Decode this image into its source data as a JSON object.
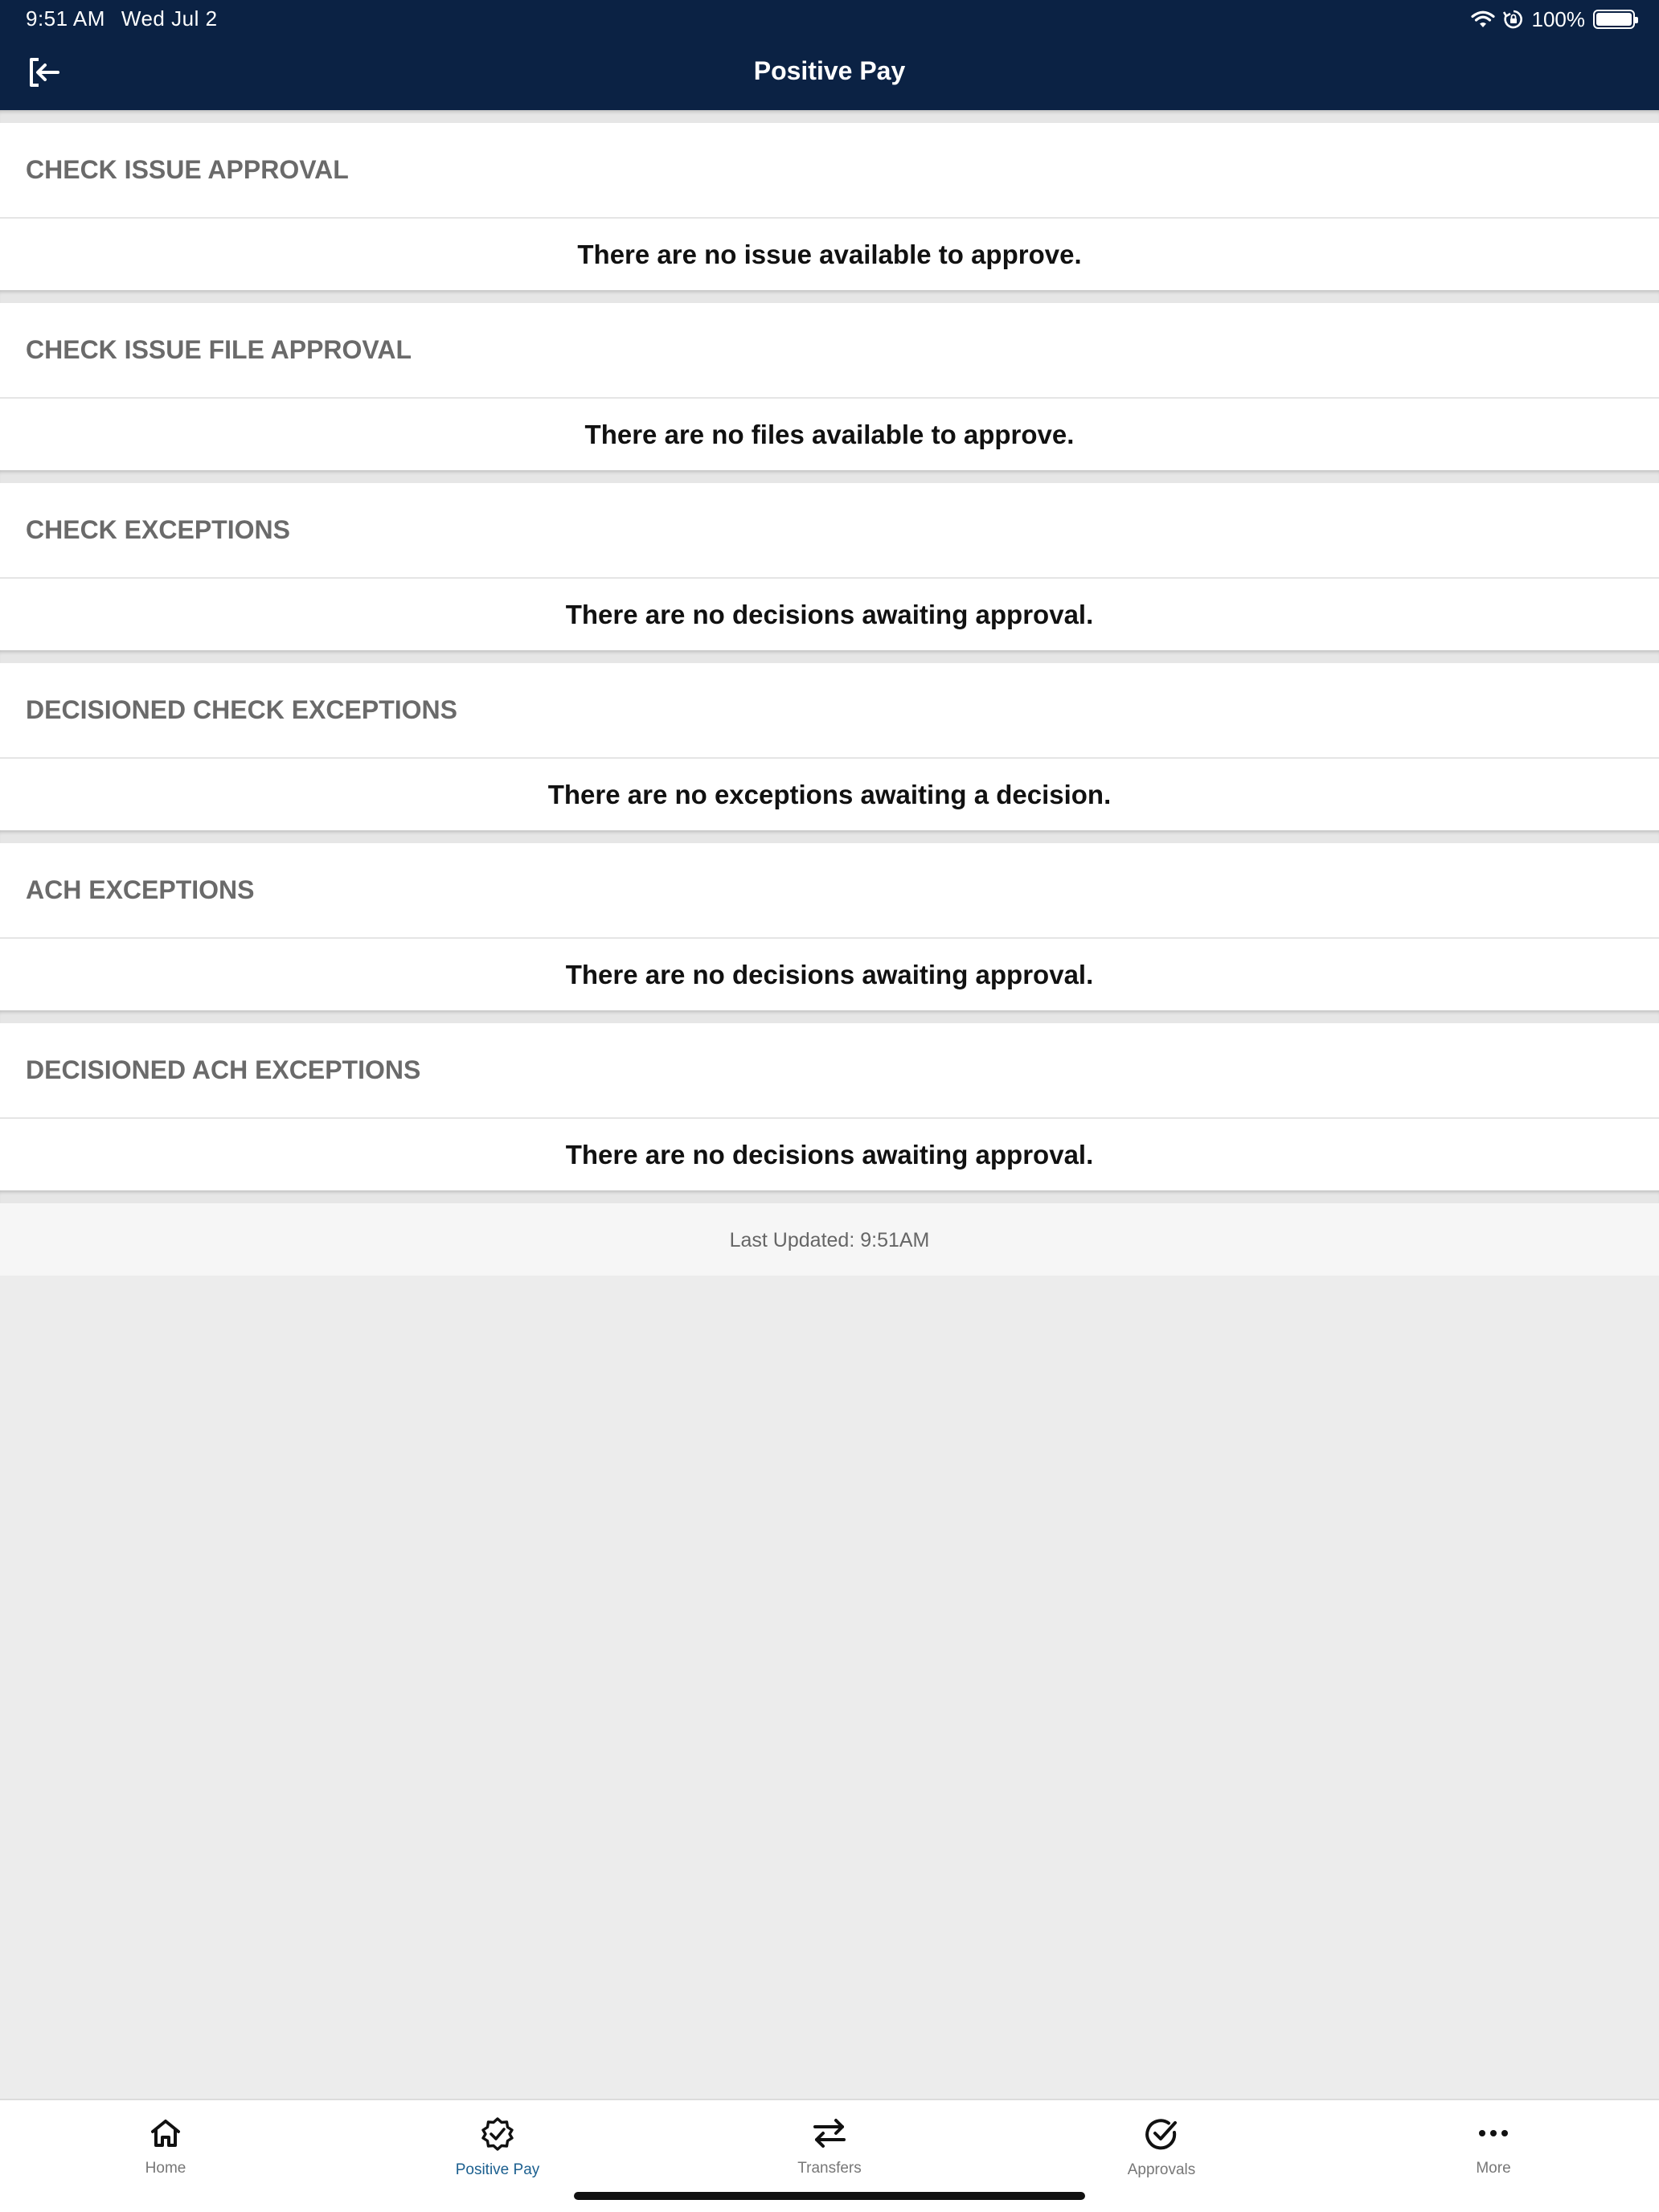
{
  "status_bar": {
    "time": "9:51 AM",
    "date": "Wed Jul 2",
    "battery": "100%",
    "icons": [
      "wifi-icon",
      "orientation-lock-icon",
      "battery-icon"
    ]
  },
  "nav": {
    "title": "Positive Pay",
    "left_icon": "logout-icon"
  },
  "sections": [
    {
      "title": "CHECK ISSUE APPROVAL",
      "message": "There are no issue available to approve."
    },
    {
      "title": "CHECK ISSUE FILE APPROVAL",
      "message": "There are no files available to approve."
    },
    {
      "title": "CHECK EXCEPTIONS",
      "message": "There are no decisions awaiting approval."
    },
    {
      "title": "DECISIONED CHECK EXCEPTIONS",
      "message": "There are no exceptions awaiting a decision."
    },
    {
      "title": "ACH EXCEPTIONS",
      "message": "There are no decisions awaiting approval."
    },
    {
      "title": "DECISIONED ACH EXCEPTIONS",
      "message": "There are no decisions awaiting approval."
    }
  ],
  "last_updated": "Last Updated: 9:51AM",
  "tabs": [
    {
      "label": "Home",
      "icon": "home-icon",
      "active": false
    },
    {
      "label": "Positive Pay",
      "icon": "badge-check-icon",
      "active": true
    },
    {
      "label": "Transfers",
      "icon": "transfer-arrows-icon",
      "active": false
    },
    {
      "label": "Approvals",
      "icon": "check-circle-icon",
      "active": false
    },
    {
      "label": "More",
      "icon": "more-dots-icon",
      "active": false
    }
  ],
  "colors": {
    "header_bg": "#0b2244",
    "active_tab": "#1b5f8f",
    "section_title": "#6a6a6a",
    "page_bg": "#ececec"
  }
}
